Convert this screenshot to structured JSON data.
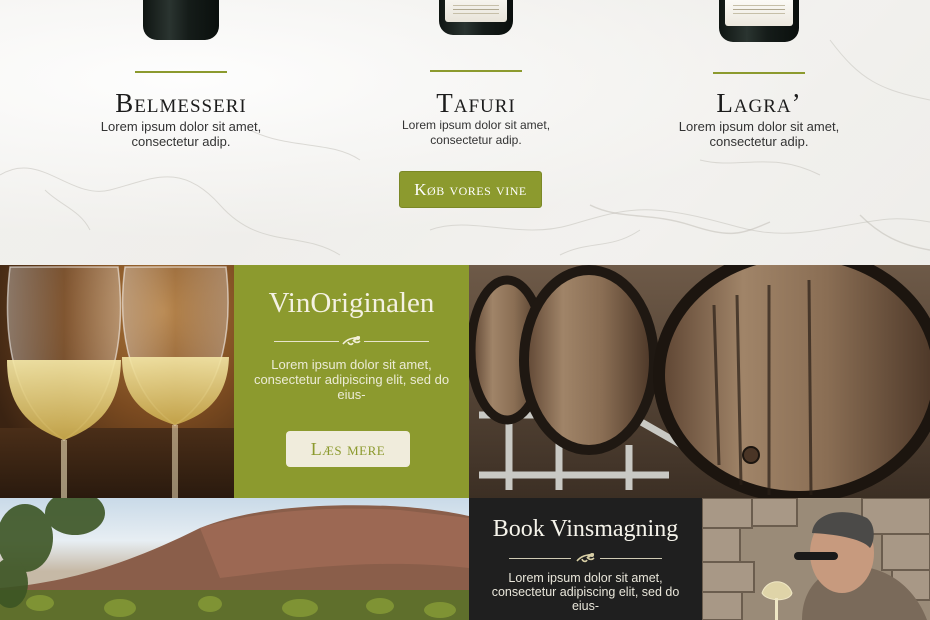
{
  "products": [
    {
      "name": "Belmesseri",
      "description": "Lorem ipsum dolor sit amet, consectetur adip."
    },
    {
      "name": "Tafuri",
      "description": "Lorem ipsum dolor sit amet, consectetur adip."
    },
    {
      "name": "Lagra’",
      "description": "Lorem ipsum dolor sit amet, consectetur adip."
    }
  ],
  "shop_button": "Køb vores vine",
  "vinoriginalen": {
    "title": "VinOriginalen",
    "text": "Lorem ipsum dolor sit amet, consectetur adipiscing elit, sed do eius-",
    "button": "Læs mere"
  },
  "vinsmagning": {
    "title": "Book Vinsmagning",
    "text": "Lorem ipsum dolor sit amet, consectetur adipiscing elit, sed do eius-"
  },
  "colors": {
    "accent_olive": "#8c9a2e",
    "dark_panel": "#1f1f1f",
    "marble": "#f3f2ef"
  }
}
